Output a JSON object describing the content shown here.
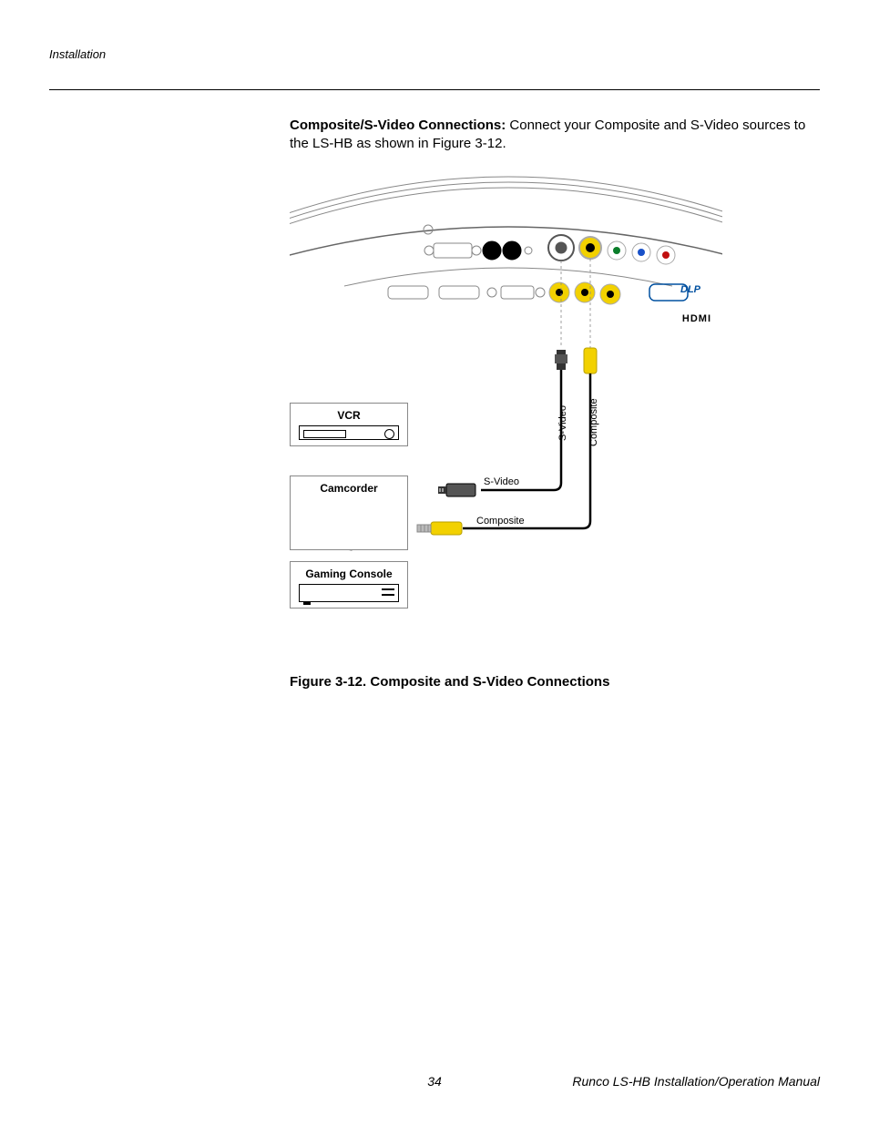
{
  "header": {
    "section_label": "Installation"
  },
  "body": {
    "heading_inline": "Composite/S-Video Connections:",
    "text": " Connect your Composite and S-Video sources to the LS-HB as shown in Figure 3-12."
  },
  "diagram": {
    "sources": {
      "vcr": "VCR",
      "camcorder": "Camcorder",
      "gaming": "Gaming Console"
    },
    "cables_h": {
      "svideo": "S-Video",
      "composite": "Composite"
    },
    "cables_v": {
      "svideo": "S-Video",
      "composite": "Composite"
    },
    "panel_logos": {
      "dlp": "DLP",
      "hdmi": "HDMI"
    }
  },
  "figure_caption": "Figure 3-12. Composite and S-Video Connections",
  "footer": {
    "page_number": "34",
    "doc_title": "Runco LS-HB Installation/Operation Manual"
  }
}
